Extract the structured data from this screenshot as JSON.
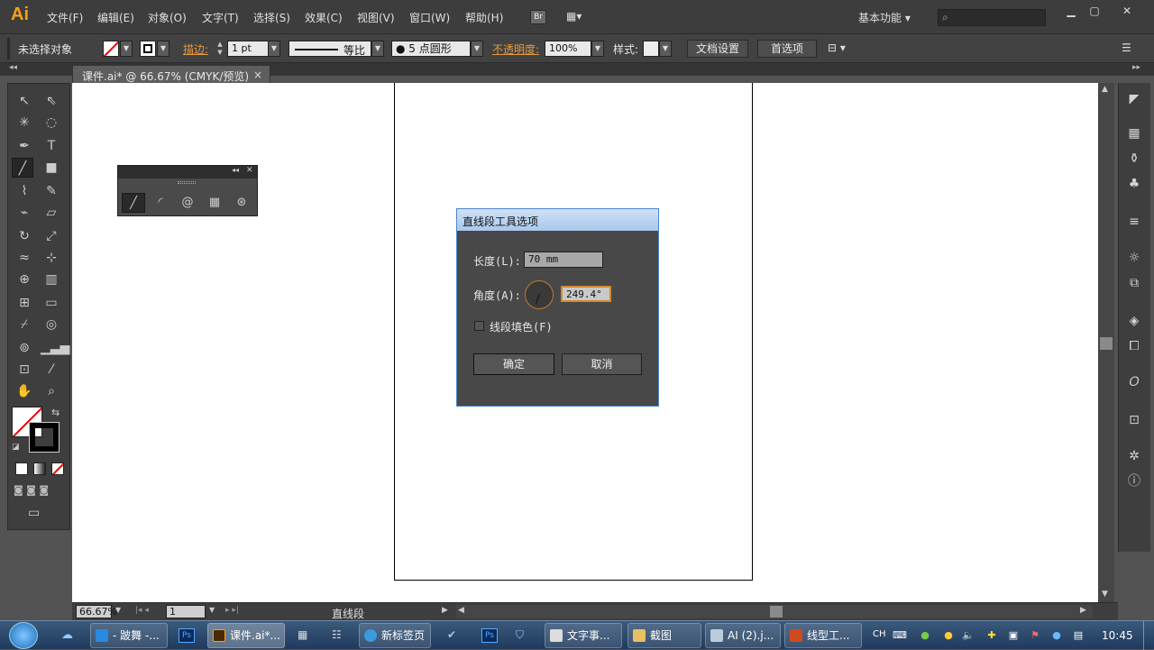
{
  "app": {
    "logo": "Ai",
    "accent": "#f7a11a",
    "menus": [
      "文件(F)",
      "编辑(E)",
      "对象(O)",
      "文字(T)",
      "选择(S)",
      "效果(C)",
      "视图(V)",
      "窗口(W)",
      "帮助(H)"
    ],
    "bridge_label": "Br",
    "workspace": "基本功能"
  },
  "control_bar": {
    "selection": "未选择对象",
    "stroke_label": "描边:",
    "stroke_weight": "1 pt",
    "stroke_profile": "等比",
    "brush": "5 点圆形",
    "opacity_label": "不透明度:",
    "opacity": "100%",
    "style_label": "样式:",
    "doc_setup": "文档设置",
    "preferences": "首选项"
  },
  "document": {
    "tab_title": "课件.ai* @ 66.67% (CMYK/预览)",
    "tab_close": "×"
  },
  "dialog": {
    "title": "直线段工具选项",
    "length_label": "长度(L):",
    "length_value": "70 mm",
    "angle_label": "角度(A):",
    "angle_value": "249.4°",
    "fill_label": "线段填色(F)",
    "ok": "确定",
    "cancel": "取消"
  },
  "status": {
    "zoom": "66.67%",
    "page": "1",
    "tool": "直线段"
  },
  "taskbar": {
    "items": [
      "- 跛舞 -...",
      "课件.ai*...",
      "新标签页",
      "文字事...",
      "截图",
      "AI (2).j...",
      "线型工..."
    ],
    "ime": "CH",
    "clock": "10:45"
  }
}
